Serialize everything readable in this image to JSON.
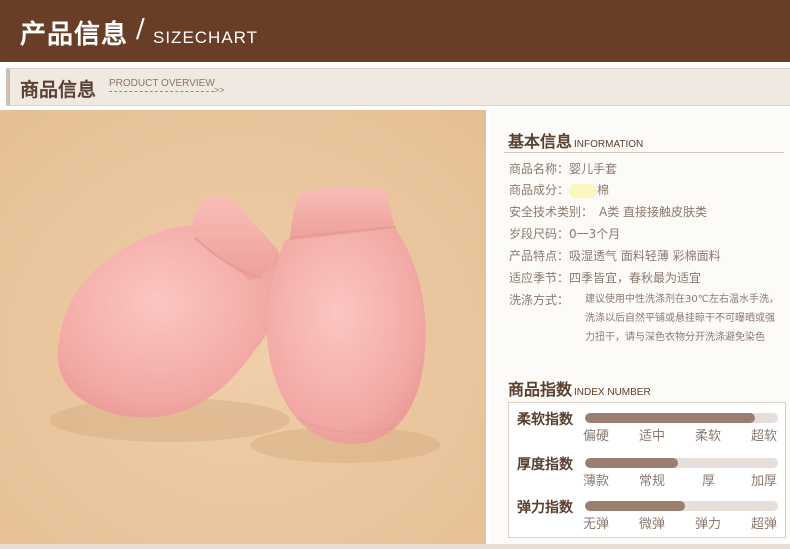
{
  "header": {
    "title": "产品信息",
    "slash": "/",
    "subtitle": "SIZECHART"
  },
  "section_bar": {
    "title": "商品信息",
    "subtitle": "PRODUCT OVERVIEW",
    "arrow": ">>"
  },
  "basic_info": {
    "title": "基本信息",
    "title_en": "INFORMATION",
    "rows": [
      {
        "label": "商品名称：",
        "value": "婴儿手套"
      },
      {
        "label": "商品成分：",
        "value": "棉"
      },
      {
        "label": "安全技术类别：",
        "value": "A类 直接接触皮肤类"
      },
      {
        "label": "岁段尺码：",
        "value": "0一3个月"
      },
      {
        "label": "产品特点：",
        "value": "吸湿透气 面料轻薄 彩棉面料"
      },
      {
        "label": "适应季节：",
        "value": "四季皆宜，春秋最为适宜"
      },
      {
        "label": "洗涤方式：",
        "value": "建议使用中性洗涤剂在30℃左右温水手洗，洗涤以后自然平铺或悬挂晾干不可曝晒或强力扭干，请与深色衣物分开洗涤避免染色"
      }
    ]
  },
  "index": {
    "title": "商品指数",
    "title_en": "INDEX NUMBER",
    "items": [
      {
        "label": "柔软指数",
        "level": 0.88,
        "ticks": [
          "偏硬",
          "适中",
          "柔软",
          "超软"
        ]
      },
      {
        "label": "厚度指数",
        "level": 0.48,
        "ticks": [
          "薄款",
          "常规",
          "厚",
          "加厚"
        ]
      },
      {
        "label": "弹力指数",
        "level": 0.52,
        "ticks": [
          "无弹",
          "微弹",
          "弹力",
          "超弹"
        ]
      }
    ]
  },
  "colors": {
    "banner": "#6a3d27",
    "photo_background": "#edc8a0",
    "mitten_pink": "#f6b3b0",
    "index_fill": "#9a7e70"
  }
}
